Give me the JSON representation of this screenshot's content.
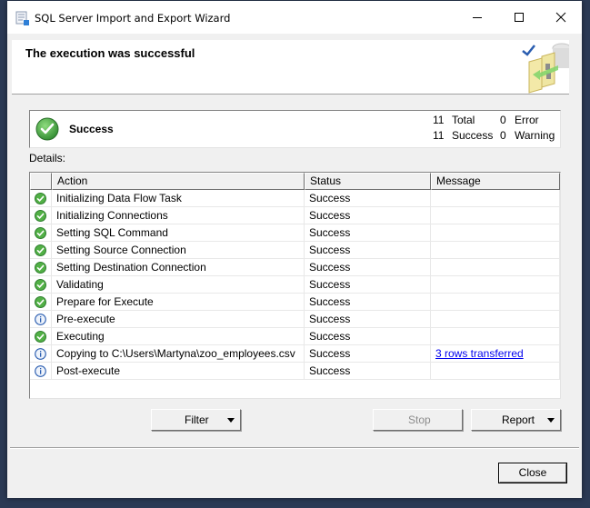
{
  "window": {
    "title": "SQL Server Import and Export Wizard",
    "controls": {
      "minimize": "minimize",
      "maximize": "maximize",
      "close": "close"
    }
  },
  "header": {
    "title": "The execution was successful",
    "icon": "wizard-success-art-icon"
  },
  "summary": {
    "status_icon": "success-check-icon",
    "status_label": "Success",
    "total_count": "11",
    "total_label": "Total",
    "success_count": "11",
    "success_label": "Success",
    "error_count": "0",
    "error_label": "Error",
    "warning_count": "0",
    "warning_label": "Warning"
  },
  "details": {
    "label": "Details:",
    "columns": [
      "",
      "Action",
      "Status",
      "Message"
    ],
    "rows": [
      {
        "icon": "success",
        "action": "Initializing Data Flow Task",
        "status": "Success",
        "message": ""
      },
      {
        "icon": "success",
        "action": "Initializing Connections",
        "status": "Success",
        "message": ""
      },
      {
        "icon": "success",
        "action": "Setting SQL Command",
        "status": "Success",
        "message": ""
      },
      {
        "icon": "success",
        "action": "Setting Source Connection",
        "status": "Success",
        "message": ""
      },
      {
        "icon": "success",
        "action": "Setting Destination Connection",
        "status": "Success",
        "message": ""
      },
      {
        "icon": "success",
        "action": "Validating",
        "status": "Success",
        "message": ""
      },
      {
        "icon": "success",
        "action": "Prepare for Execute",
        "status": "Success",
        "message": ""
      },
      {
        "icon": "info",
        "action": "Pre-execute",
        "status": "Success",
        "message": ""
      },
      {
        "icon": "success",
        "action": "Executing",
        "status": "Success",
        "message": ""
      },
      {
        "icon": "info",
        "action": "Copying to C:\\Users\\Martyna\\zoo_employees.csv",
        "status": "Success",
        "message": "3 rows transferred"
      },
      {
        "icon": "info",
        "action": "Post-execute",
        "status": "Success",
        "message": ""
      }
    ]
  },
  "buttons": {
    "filter": "Filter",
    "stop": "Stop",
    "report": "Report",
    "close": "Close"
  },
  "colors": {
    "desktop": "#2b3a55",
    "dialog": "#f0f0f0",
    "success_green": "#3c9a3c",
    "info_blue": "#2a5db0",
    "link": "#0000ee",
    "disabled_text": "#8d8d8d"
  }
}
